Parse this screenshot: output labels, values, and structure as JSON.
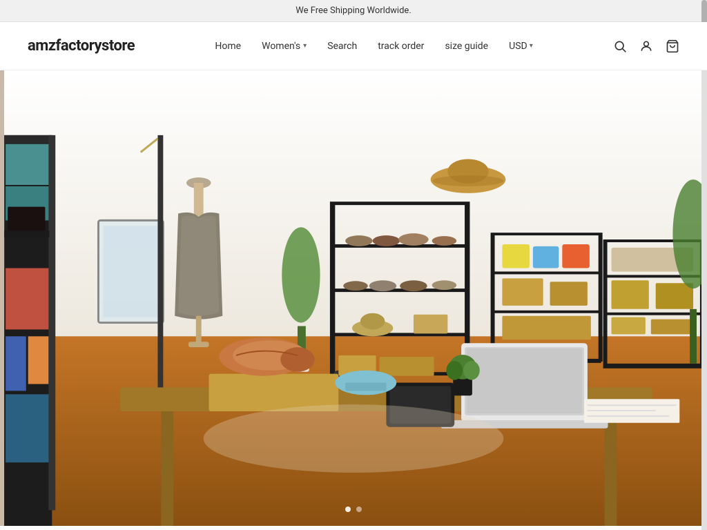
{
  "announcement": {
    "text": "We Free Shipping Worldwide."
  },
  "header": {
    "logo": "amzfactorystore",
    "nav": {
      "home": "Home",
      "womens": "Women's",
      "search": "Search",
      "track_order": "track order",
      "size_guide": "size guide",
      "currency": "USD"
    },
    "icons": {
      "search": "🔍",
      "account": "👤",
      "cart": "🛒"
    }
  },
  "hero": {
    "slide_current": 1,
    "slide_total": 2
  }
}
